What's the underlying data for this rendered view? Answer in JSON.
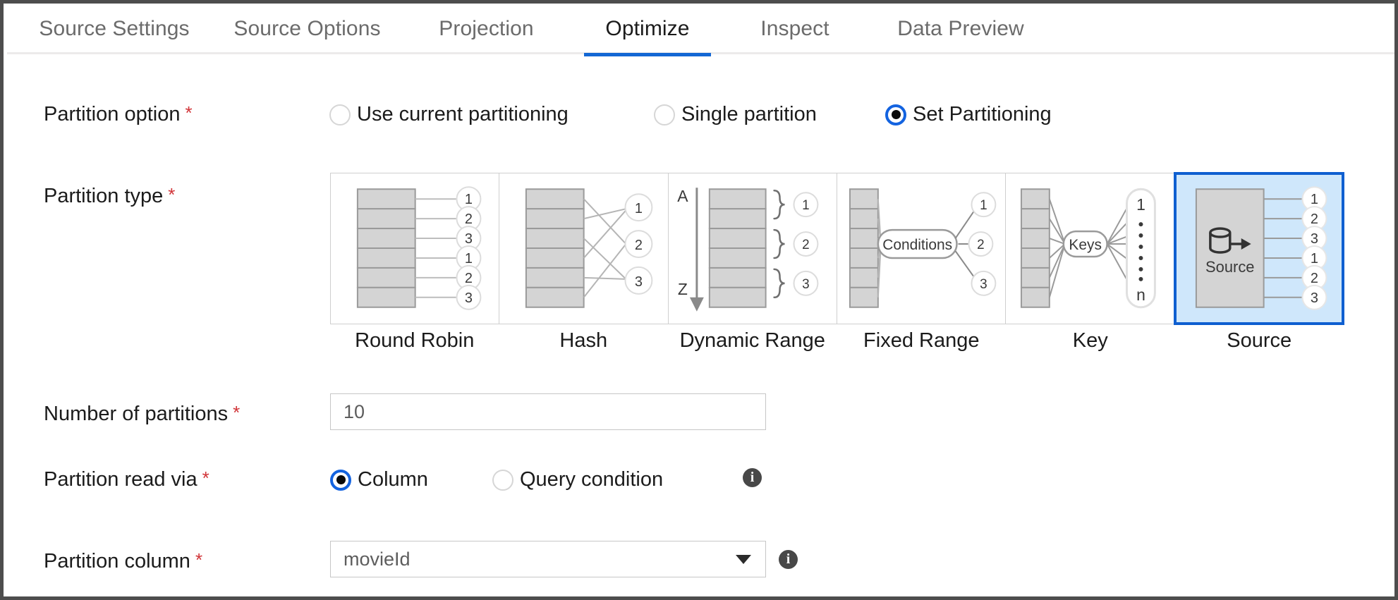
{
  "tabs": [
    {
      "label": "Source Settings",
      "active": false
    },
    {
      "label": "Source Options",
      "active": false
    },
    {
      "label": "Projection",
      "active": false
    },
    {
      "label": "Optimize",
      "active": true
    },
    {
      "label": "Inspect",
      "active": false
    },
    {
      "label": "Data Preview",
      "active": false
    }
  ],
  "partition_option": {
    "label": "Partition option",
    "required_marker": "*",
    "options": [
      {
        "label": "Use current partitioning",
        "selected": false
      },
      {
        "label": "Single partition",
        "selected": false
      },
      {
        "label": "Set Partitioning",
        "selected": true
      }
    ]
  },
  "partition_type": {
    "label": "Partition type",
    "required_marker": "*",
    "options": [
      {
        "label": "Round Robin",
        "selected": false,
        "circles": [
          "1",
          "2",
          "3",
          "1",
          "2",
          "3"
        ]
      },
      {
        "label": "Hash",
        "selected": false,
        "circles": [
          "1",
          "2",
          "3"
        ]
      },
      {
        "label": "Dynamic Range",
        "selected": false,
        "circles": [
          "1",
          "2",
          "3"
        ],
        "range_start": "A",
        "range_end": "Z"
      },
      {
        "label": "Fixed Range",
        "selected": false,
        "circles": [
          "1",
          "2",
          "3"
        ],
        "node_label": "Conditions"
      },
      {
        "label": "Key",
        "selected": false,
        "node_label": "Keys",
        "capsule_top": "1",
        "capsule_bottom": "n"
      },
      {
        "label": "Source",
        "selected": true,
        "circles": [
          "1",
          "2",
          "3",
          "1",
          "2",
          "3"
        ],
        "node_label": "Source"
      }
    ]
  },
  "number_of_partitions": {
    "label": "Number of partitions",
    "required_marker": "*",
    "value": "10",
    "placeholder": ""
  },
  "partition_read_via": {
    "label": "Partition read via",
    "required_marker": "*",
    "options": [
      {
        "label": "Column",
        "selected": true
      },
      {
        "label": "Query condition",
        "selected": false
      }
    ],
    "info_icon": "info-icon"
  },
  "partition_column": {
    "label": "Partition column",
    "required_marker": "*",
    "value": "movieId",
    "caret_icon": "chevron-down-icon",
    "info_icon": "info-icon"
  },
  "colors": {
    "accent": "#1367d4",
    "selected_card_border": "#0f5fd0",
    "selected_card_fill": "#cfe7fb",
    "required_asterisk": "#d13438",
    "diagram_gray": "#d4d4d4",
    "diagram_stroke": "#9a9a9a"
  }
}
